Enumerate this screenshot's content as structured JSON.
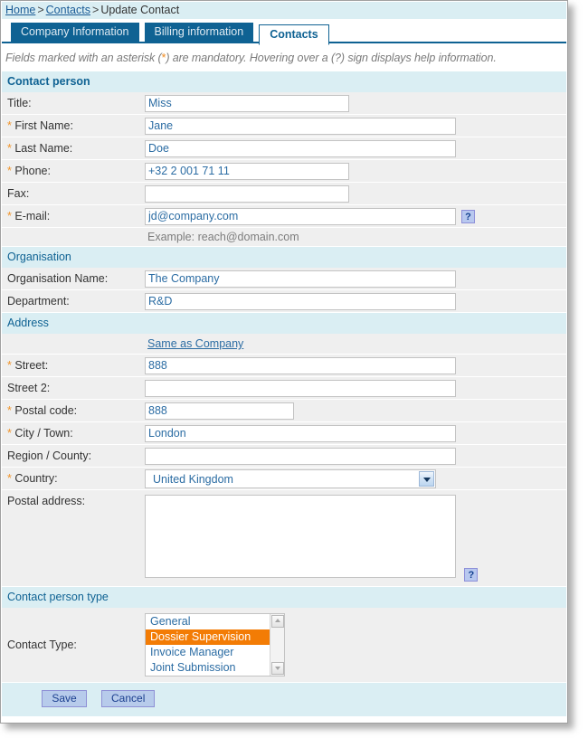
{
  "breadcrumb": {
    "home": "Home",
    "sep1": ">",
    "contacts": "Contacts",
    "sep2": ">",
    "current": "Update Contact"
  },
  "tabs": [
    {
      "label": "Company Information",
      "active": false
    },
    {
      "label": "Billing information",
      "active": false
    },
    {
      "label": "Contacts",
      "active": true
    }
  ],
  "note": {
    "part1": "Fields marked with an asterisk (",
    "asterisk": "*",
    "part2": ") are mandatory. Hovering over a (?) sign displays help information."
  },
  "sections": {
    "contact_person": {
      "title": "Contact person",
      "title_ული": "",
      "fields": {
        "title_label": "Title:",
        "title_value": "Miss",
        "first_name_label": "First Name:",
        "first_name_value": "Jane",
        "last_name_label": "Last Name:",
        "last_name_value": "Doe",
        "phone_label": "Phone:",
        "phone_value": "+32 2 001 71 11",
        "fax_label": "Fax:",
        "fax_value": "",
        "email_label": "E-mail:",
        "email_value": "jd@company.com",
        "email_hint": "Example: reach@domain.com",
        "email_help": "?"
      }
    },
    "organisation": {
      "title": "Organisation",
      "fields": {
        "org_name_label": "Organisation Name:",
        "org_name_value": "The Company",
        "department_label": "Department:",
        "department_value": "R&D"
      }
    },
    "address": {
      "title": "Address",
      "same_as_company_link": "Same as Company",
      "fields": {
        "street_label": "Street:",
        "street_value": "888",
        "street2_label": "Street 2:",
        "street2_value": "",
        "postal_code_label": "Postal code:",
        "postal_code_value": "888",
        "city_label": "City / Town:",
        "city_value": "London",
        "region_label": "Region / County:",
        "region_value": "",
        "country_label": "Country:",
        "country_value": "United Kingdom",
        "postal_address_label": "Postal address:",
        "postal_address_value": "",
        "postal_address_help": "?"
      }
    },
    "contact_person_type": {
      "title": "Contact person type",
      "contact_type_label": "Contact Type:",
      "options": [
        {
          "label": "General",
          "selected": false
        },
        {
          "label": "Dossier Supervision",
          "selected": true
        },
        {
          "label": "Invoice Manager",
          "selected": false
        },
        {
          "label": "Joint Submission",
          "selected": false
        }
      ]
    }
  },
  "footer": {
    "save_label": "Save",
    "cancel_label": "Cancel"
  },
  "colors": {
    "accent_blue": "#0f6293",
    "section_bg": "#daeef3",
    "row_bg": "#efefef",
    "field_text": "#2b6ca3",
    "mandatory_asterisk": "#f0942a",
    "selection_orange": "#f37c05",
    "button_bg": "#b7cbeb",
    "button_border": "#8e90d5"
  }
}
